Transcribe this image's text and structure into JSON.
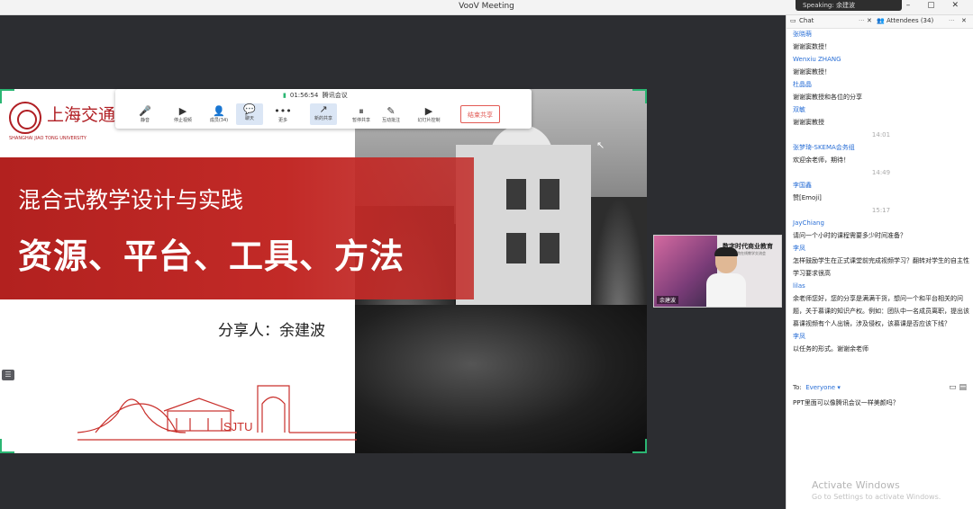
{
  "window": {
    "title": "VooV Meeting",
    "speaking": "Speaking: 余建波",
    "controls": "–  ▢  ✕"
  },
  "slide": {
    "logo_cn": "上海交通",
    "logo_en": "SHANGHAI JIAO TONG UNIVERSITY",
    "subtitle": "混合式教学设计与实践",
    "title": "资源、平台、工具、方法",
    "author": "分享人：余建波",
    "sjtu_mark": "SJTU"
  },
  "toolbar": {
    "time": "01:56:54",
    "meeting_name": "腾讯会议",
    "items": [
      {
        "icon": "🎤",
        "label": "静音"
      },
      {
        "icon": "▶",
        "label": "停止视频"
      },
      {
        "icon": "👤",
        "label": "成员(34)"
      },
      {
        "icon": "💬",
        "label": "聊天"
      },
      {
        "icon": "•••",
        "label": "更多"
      },
      {
        "icon": "↗",
        "label": "新的共享"
      },
      {
        "icon": "⏸",
        "label": "暂停共享"
      },
      {
        "icon": "✎",
        "label": "互动批注"
      },
      {
        "icon": "▶",
        "label": "幻灯片控制"
      }
    ],
    "end_share": "结束共享"
  },
  "video_tile": {
    "poster_title": "数字时代商业教育",
    "poster_sub": "全球商学院在线教学交流会",
    "name": "余建波"
  },
  "panel": {
    "chat_tab": "Chat",
    "attendees_tab": "Attendees (34)",
    "messages": [
      {
        "type": "msg",
        "name": "张晓萌",
        "text": "谢谢窦数授！"
      },
      {
        "type": "msg",
        "name": "Wenxiu ZHANG",
        "text": "谢谢窦教授！"
      },
      {
        "type": "msg",
        "name": "杜晶晶",
        "text": "谢谢窦教授和各位的分享"
      },
      {
        "type": "msg",
        "name": "双敏",
        "text": "谢谢窦教授"
      },
      {
        "type": "time",
        "text": "14:01"
      },
      {
        "type": "msg",
        "name": "张梦琦-SKEMA会务组",
        "text": "欢迎余老师，期待！"
      },
      {
        "type": "time",
        "text": "14:49"
      },
      {
        "type": "msg",
        "name": "李国鑫",
        "text": "赞[Emoji]"
      },
      {
        "type": "time",
        "text": "15:17"
      },
      {
        "type": "msg",
        "name": "JayChiang",
        "text": "请问一个小时的课程需要多少时间准备？"
      },
      {
        "type": "msg",
        "name": "李凤",
        "text": "怎样鼓励学生在正式课堂前完成视频学习？翻转对学生的自主性学习要求很高"
      },
      {
        "type": "msg",
        "name": "lilas",
        "text": "余老师您好，您的分享是满满干货，想问一个和平台相关的问题，关于慕课的知识产权。例如：团队中一名成员离职，提出该慕课视频有个人出镜，涉及侵权，该慕课是否应该下线？"
      },
      {
        "type": "msg",
        "name": "李凤",
        "text": "以任务的形式。谢谢余老师"
      }
    ],
    "to_label": "To:",
    "to_value": "Everyone ▾",
    "compose_text": "PPT里面可以像腾讯会议一样美颜吗？",
    "activate_title": "Activate Windows",
    "activate_sub": "Go to Settings to activate Windows."
  }
}
